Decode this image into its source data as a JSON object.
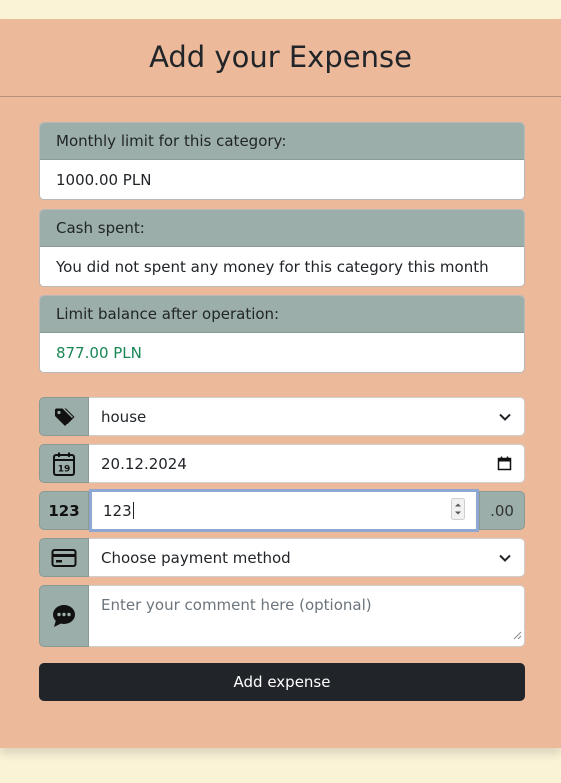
{
  "title": "Add your Expense",
  "monthly_limit": {
    "label": "Monthly limit for this category:",
    "value": "1000.00 PLN"
  },
  "cash_spent": {
    "label": "Cash spent:",
    "value": "You did not spent any money for this category this month"
  },
  "limit_balance": {
    "label": "Limit balance after operation:",
    "value": "877.00 PLN",
    "color": "#198754"
  },
  "form": {
    "category": {
      "value": "house",
      "icon": "tag-icon"
    },
    "date": {
      "value": "20.12.2024",
      "icon": "calendar-icon",
      "icon_day": "19"
    },
    "amount": {
      "prefix": "123",
      "value": "123",
      "suffix": ".00"
    },
    "payment": {
      "value": "Choose payment method",
      "icon": "credit-card-icon"
    },
    "comment": {
      "placeholder": "Enter your comment here (optional)",
      "icon": "chat-icon"
    }
  },
  "submit_label": "Add expense",
  "colors": {
    "background": "#faf3d6",
    "card": "#ecb99a",
    "addon": "#9caea9",
    "button": "#212529"
  }
}
